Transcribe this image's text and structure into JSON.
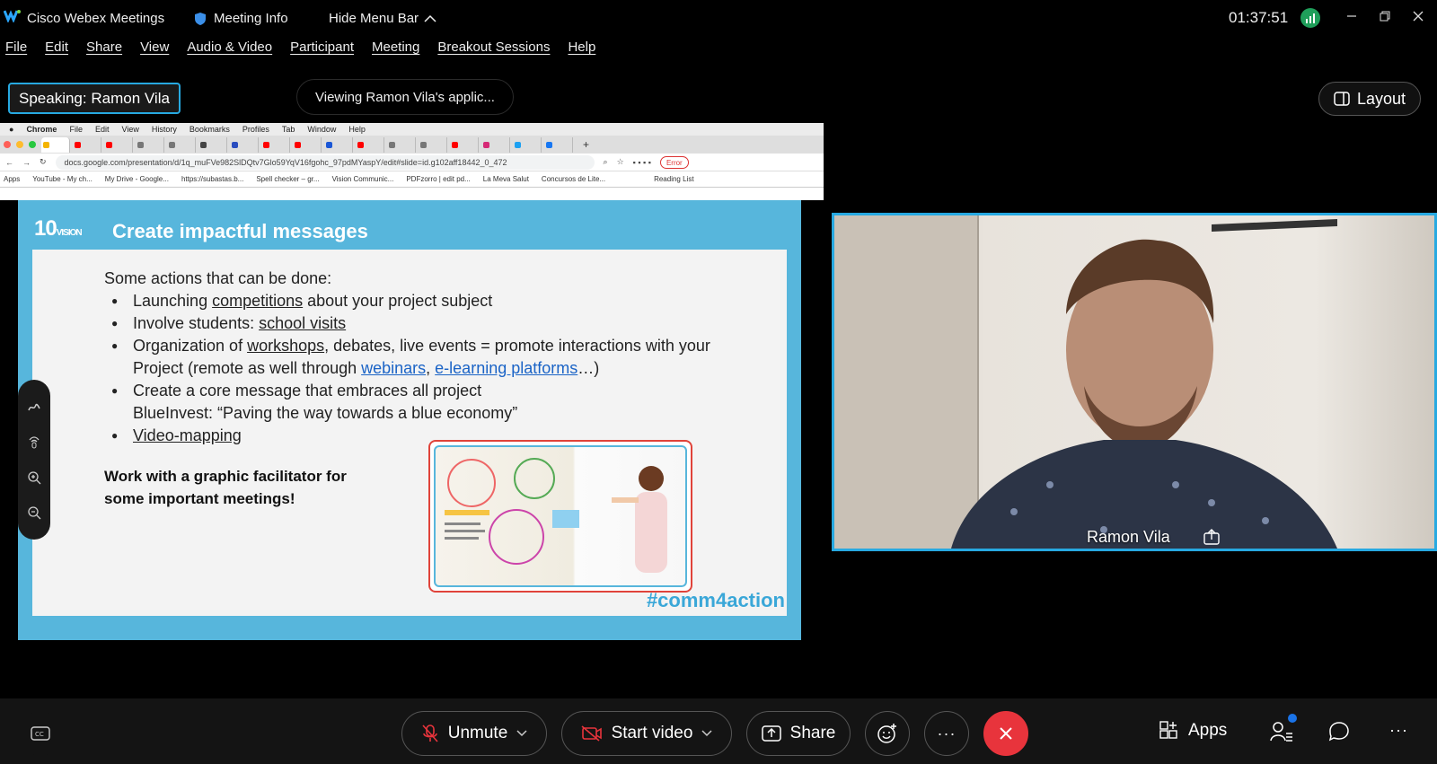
{
  "titlebar": {
    "app_name": "Cisco Webex Meetings",
    "meeting_info": "Meeting Info",
    "hide_menu": "Hide Menu Bar",
    "clock": "01:37:51"
  },
  "menu": [
    "File",
    "Edit",
    "Share",
    "View",
    "Audio & Video",
    "Participant",
    "Meeting",
    "Breakout Sessions",
    "Help"
  ],
  "speaking": {
    "label": "Speaking:",
    "name": "Ramon Vila"
  },
  "viewing": "Viewing Ramon Vila's applic...",
  "layout_label": "Layout",
  "browser": {
    "menu": [
      "Chrome",
      "File",
      "Edit",
      "View",
      "History",
      "Bookmarks",
      "Profiles",
      "Tab",
      "Window",
      "Help"
    ],
    "url": "docs.google.com/presentation/d/1q_muFVe982SlDQtv7Glo59YqV16fgohc_97pdMYaspY/edit#slide=id.g102aff18442_0_472",
    "error_label": "Error",
    "bookmarks": [
      "Apps",
      "YouTube - My ch...",
      "My Drive - Google...",
      "https://subastas.b...",
      "Spell checker – gr...",
      "Vision Communic...",
      "PDFzorro | edit pd...",
      "La Meva Salut",
      "Concursos de Lite..."
    ],
    "reading_list": "Reading List"
  },
  "slide": {
    "title": "Create impactful messages",
    "intro": "Some actions that can be done:",
    "b1_pre": "Launching ",
    "b1_link": "competitions",
    "b1_post": " about your project subject",
    "b2_pre": "Involve students: ",
    "b2_link": "school visits",
    "b3_pre": "Organization of ",
    "b3_link": "workshops",
    "b3_mid": ", debates, live events = promote interactions with your Project (remote as well through ",
    "b3_link2": "webinars",
    "b3_comma": ", ",
    "b3_link3": "e-learning platforms",
    "b3_post": "…)",
    "b4_line1": "Create a core message that embraces all project",
    "b4_line2": "BlueInvest: “Paving the way towards a blue economy”",
    "b5_link": "Video-mapping",
    "note_line1": "Work with a graphic facilitator for",
    "note_line2": "some important meetings!",
    "hashtag": "#comm4action"
  },
  "video": {
    "name": "Ramon Vila"
  },
  "controls": {
    "unmute": "Unmute",
    "start_video": "Start video",
    "share": "Share",
    "apps": "Apps"
  },
  "colors": {
    "accent": "#27a9e1",
    "end_call": "#e8343c",
    "slide_blue": "#57b6dc"
  }
}
